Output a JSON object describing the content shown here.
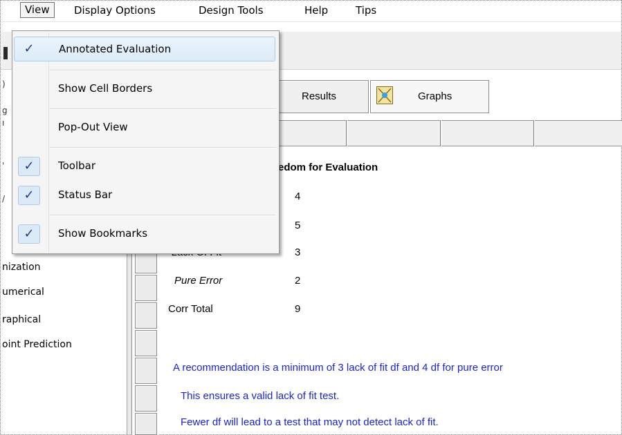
{
  "menubar": {
    "items": [
      "View",
      "Display Options",
      "Design Tools",
      "Help",
      "Tips"
    ]
  },
  "view_menu": {
    "items": [
      {
        "label": "Annotated Evaluation",
        "checked": true,
        "highlighted": true
      },
      {
        "label": "Show Cell Borders",
        "checked": false
      },
      {
        "label": "Pop-Out View",
        "checked": false
      },
      {
        "label": "Toolbar",
        "checked": true
      },
      {
        "label": "Status Bar",
        "checked": true
      },
      {
        "label": "Show Bookmarks",
        "checked": true
      }
    ],
    "check_glyph": "✓"
  },
  "left_tree": {
    "items": [
      "nization",
      "umerical",
      "raphical",
      "oint Prediction"
    ]
  },
  "tabs": {
    "results": "Results",
    "graphs": "Graphs",
    "graphs_icon": "graph-icon"
  },
  "report": {
    "heading_fragment": "edom for Evaluation",
    "rows": [
      {
        "label": "",
        "value": "4"
      },
      {
        "label": "",
        "value": "5"
      },
      {
        "label": "Lack Of Fit",
        "value": "3"
      },
      {
        "label": "Pure Error",
        "value": "2"
      },
      {
        "label": "Corr Total",
        "value": "9"
      }
    ],
    "notes": [
      "A recommendation is a minimum of 3 lack of fit df and 4 df for pure error",
      "This ensures a valid lack of fit test.",
      "Fewer df will lead to a test that may not detect lack of fit."
    ]
  },
  "colors": {
    "note_blue": "#1a24d6",
    "menu_highlight": "#dcecf8",
    "check_blue": "#223a8a"
  }
}
